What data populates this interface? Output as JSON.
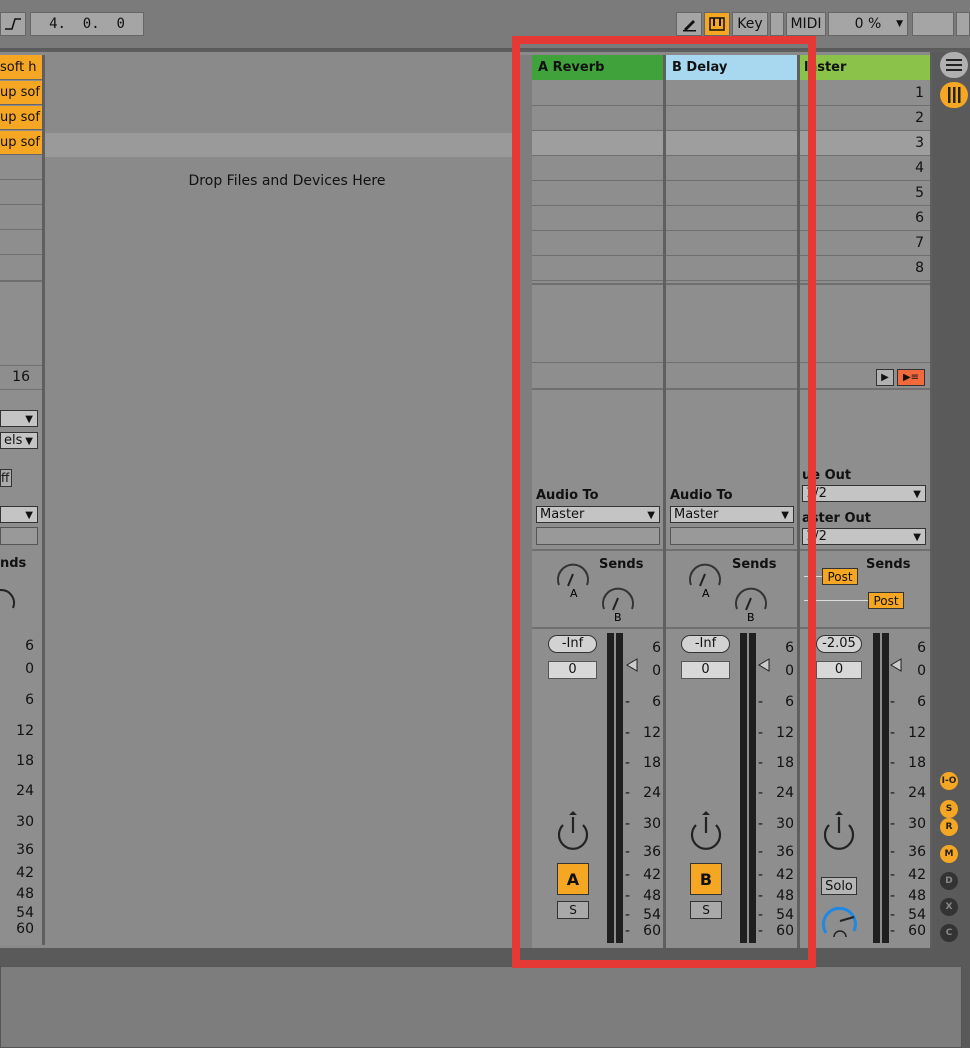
{
  "toolbar": {
    "position": "4.  0.  0",
    "key_label": "Key",
    "midi_label": "MIDI",
    "cpu": "0 %"
  },
  "left_track": {
    "clips": [
      "soft h",
      "up sof",
      "up sof",
      "up sof"
    ],
    "bar_value": "16",
    "off_label": "ff",
    "select_label": "els",
    "sends_label": "nds"
  },
  "drop_zone": {
    "text": "Drop Files and Devices Here"
  },
  "return_a": {
    "name": "A Reverb",
    "color": "#3fa23a",
    "audio_to_label": "Audio To",
    "audio_to_value": "Master",
    "sends_label": "Sends",
    "knob_a": "A",
    "knob_b": "B",
    "volume_pill": "-Inf",
    "pan_value": "0",
    "activator": "A",
    "solo": "S"
  },
  "return_b": {
    "name": "B Delay",
    "color": "#a8d8f0",
    "audio_to_label": "Audio To",
    "audio_to_value": "Master",
    "sends_label": "Sends",
    "knob_a": "A",
    "knob_b": "B",
    "volume_pill": "-Inf",
    "pan_value": "0",
    "activator": "B",
    "solo": "S"
  },
  "master": {
    "name": "laster",
    "color": "#8bc34a",
    "scenes": [
      "1",
      "2",
      "3",
      "4",
      "5",
      "6",
      "7",
      "8"
    ],
    "cue_out_label": "ue Out",
    "cue_out_value": "1/2",
    "master_out_label": "aster Out",
    "master_out_value": "1/2",
    "sends_label": "Sends",
    "post_1": "Post",
    "post_2": "Post",
    "volume_pill": "-2.05",
    "pan_value": "0",
    "solo_label": "Solo"
  },
  "meter_scale": [
    "6",
    "0",
    "6",
    "12",
    "18",
    "24",
    "30",
    "36",
    "42",
    "48",
    "54",
    "60"
  ],
  "side_buttons": [
    "I-O",
    "S",
    "R",
    "M",
    "D",
    "X",
    "C"
  ],
  "colors": {
    "orange": "#f5a623",
    "highlight_red": "#e53935",
    "panel": "#8e8e8e"
  }
}
